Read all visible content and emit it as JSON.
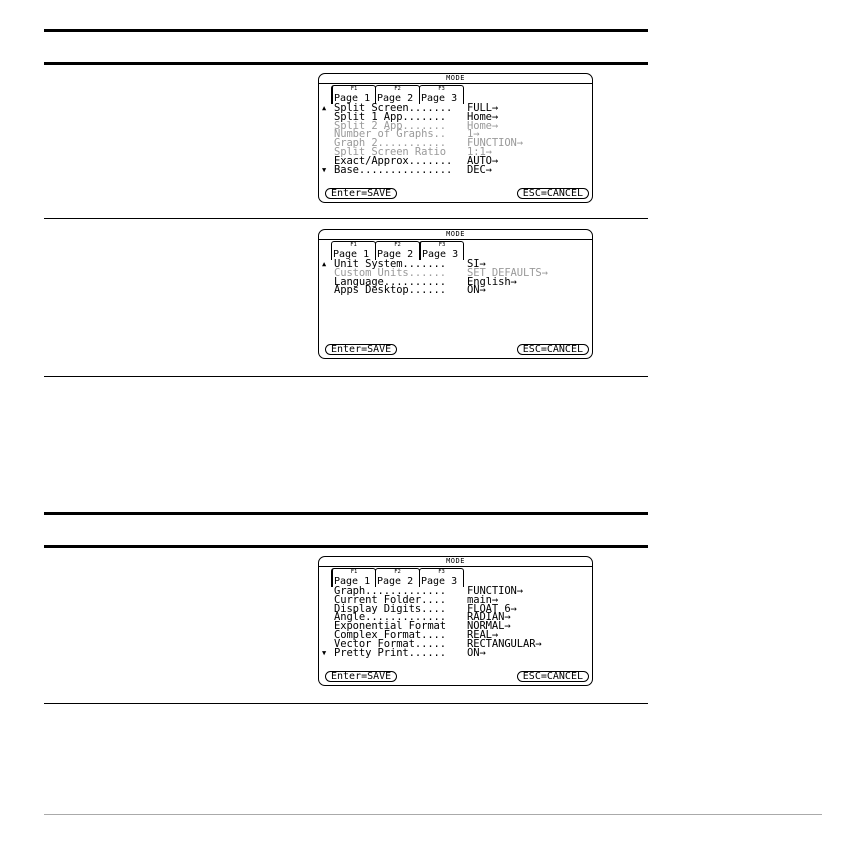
{
  "dialogs": [
    {
      "title": "MODE",
      "tabs": [
        {
          "fkey": "F1",
          "label": "Page 1"
        },
        {
          "fkey": "F2",
          "label": "Page 2"
        },
        {
          "fkey": "F3",
          "label": "Page 3"
        }
      ],
      "rows": [
        {
          "arrow": "▲",
          "label": "Split Screen.......",
          "value": "FULL→"
        },
        {
          "arrow": "",
          "label": "Split 1 App.......",
          "value": "Home→"
        },
        {
          "arrow": "",
          "label": "Split 2 App.......",
          "value": "Home→"
        },
        {
          "arrow": "",
          "label": "Number of Graphs..",
          "value": "1→"
        },
        {
          "arrow": "",
          "label": "Graph 2...........",
          "value": "FUNCTION→"
        },
        {
          "arrow": "",
          "label": "Split Screen Ratio",
          "value": "1:1→"
        },
        {
          "arrow": "",
          "label": "Exact/Approx.......",
          "value": "AUTO→"
        },
        {
          "arrow": "▼",
          "label": "Base...............",
          "value": "DEC→"
        }
      ],
      "save_label": "Enter=SAVE",
      "cancel_label": "ESC=CANCEL"
    },
    {
      "title": "MODE",
      "tabs": [
        {
          "fkey": "F1",
          "label": "Page 1"
        },
        {
          "fkey": "F2",
          "label": "Page 2"
        },
        {
          "fkey": "F3",
          "label": "Page 3"
        }
      ],
      "rows": [
        {
          "arrow": "▲",
          "label": "Unit System.......",
          "value": "SI→"
        },
        {
          "arrow": "",
          "label": "Custom Units......",
          "value": "SET DEFAULTS→"
        },
        {
          "arrow": "",
          "label": "Language..........",
          "value": "English→"
        },
        {
          "arrow": "",
          "label": "Apps Desktop......",
          "value": "ON→"
        }
      ],
      "save_label": "Enter=SAVE",
      "cancel_label": "ESC=CANCEL"
    },
    {
      "title": "MODE",
      "tabs": [
        {
          "fkey": "F1",
          "label": "Page 1"
        },
        {
          "fkey": "F2",
          "label": "Page 2"
        },
        {
          "fkey": "F3",
          "label": "Page 3"
        }
      ],
      "rows": [
        {
          "arrow": "",
          "label": "Graph.............",
          "value": "FUNCTION→"
        },
        {
          "arrow": "",
          "label": "Current Folder....",
          "value": "main→"
        },
        {
          "arrow": "",
          "label": "Display Digits....",
          "value": "FLOAT 6→"
        },
        {
          "arrow": "",
          "label": "Angle.............",
          "value": "RADIAN→"
        },
        {
          "arrow": "",
          "label": "Exponential Format",
          "value": "NORMAL→"
        },
        {
          "arrow": "",
          "label": "Complex Format....",
          "value": "REAL→"
        },
        {
          "arrow": "",
          "label": "Vector Format.....",
          "value": "RECTANGULAR→"
        },
        {
          "arrow": "▼",
          "label": "Pretty Print......",
          "value": "ON→"
        }
      ],
      "save_label": "Enter=SAVE",
      "cancel_label": "ESC=CANCEL"
    }
  ]
}
